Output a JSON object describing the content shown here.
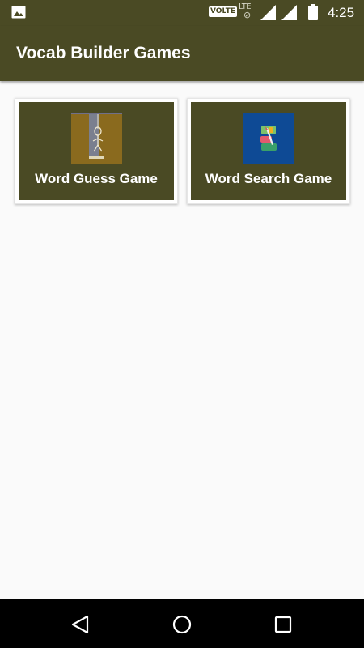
{
  "status_bar": {
    "network_badge": "VOLTE",
    "lte_label": "LTE",
    "lte_symbol": "⊘",
    "time": "4:25",
    "icons": [
      "gallery-icon",
      "signal-icon",
      "signal-icon",
      "battery-icon"
    ]
  },
  "app_bar": {
    "title": "Vocab Builder Games"
  },
  "games": [
    {
      "label": "Word Guess Game",
      "icon": "hangman-icon",
      "bg_color": "#8a6a1e"
    },
    {
      "label": "Word Search Game",
      "icon": "word-search-icon",
      "bg_color": "#0e4a95"
    }
  ],
  "nav_bar": {
    "buttons": [
      "back-icon",
      "home-icon",
      "recents-icon"
    ]
  },
  "colors": {
    "primary": "#4a4a24",
    "background": "#fafafa",
    "card": "#ffffff"
  }
}
